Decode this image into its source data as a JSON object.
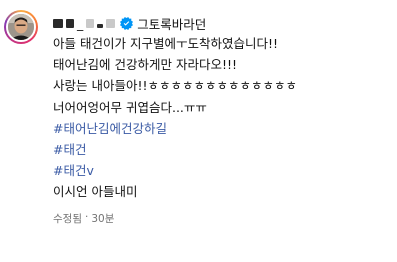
{
  "post": {
    "username_visible": "_",
    "display_name": "그토록바라던",
    "lines": [
      "아들 태건이가 지구별에ㅜ도착하였습니다!!",
      "태어난김에 건강하게만 자라다오!!!",
      "사랑는 내아들아!!ㅎㅎㅎㅎㅎㅎㅎㅎㅎㅎㅎㅎㅎ",
      "너어어엉어무 귀엽슴다...ㅠㅠ"
    ],
    "hashtags": [
      "#태어난김에건강하길",
      "#태건",
      "#태건v"
    ],
    "closing_line": "이시언 아들내미",
    "meta": {
      "edited": "수정됨",
      "separator": "·",
      "time": "30분"
    }
  },
  "icons": {
    "verified": "verified-badge-icon",
    "avatar": "profile-avatar"
  },
  "colors": {
    "hashtag": "#3b5ba5",
    "verified": "#0095f6",
    "meta": "#737373"
  }
}
